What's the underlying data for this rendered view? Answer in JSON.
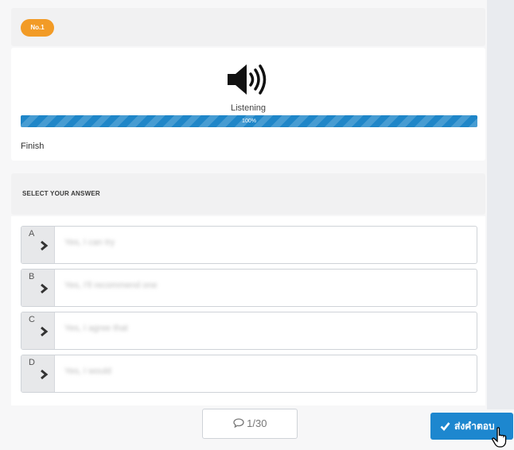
{
  "question": {
    "number_badge": "No.1",
    "media_label": "Listening",
    "progress": {
      "percent": 100,
      "label": "100%"
    },
    "status_text": "Finish"
  },
  "answers": {
    "header": "SELECT YOUR ANSWER",
    "options": [
      {
        "letter": "A",
        "text": "Yes, I can try"
      },
      {
        "letter": "B",
        "text": "Yes, I'll recommend one"
      },
      {
        "letter": "C",
        "text": "Yes, I agree that"
      },
      {
        "letter": "D",
        "text": "Yes, I would"
      }
    ]
  },
  "footer": {
    "counter": "1/30",
    "submit_label": "ส่งคำตอบ"
  },
  "colors": {
    "badge": "#f29b26",
    "progress": "#1f86c8",
    "submit": "#1d87cf"
  },
  "icons": [
    "speaker-icon",
    "chevron-right-icon",
    "comment-icon",
    "check-icon",
    "hand-cursor-icon"
  ]
}
